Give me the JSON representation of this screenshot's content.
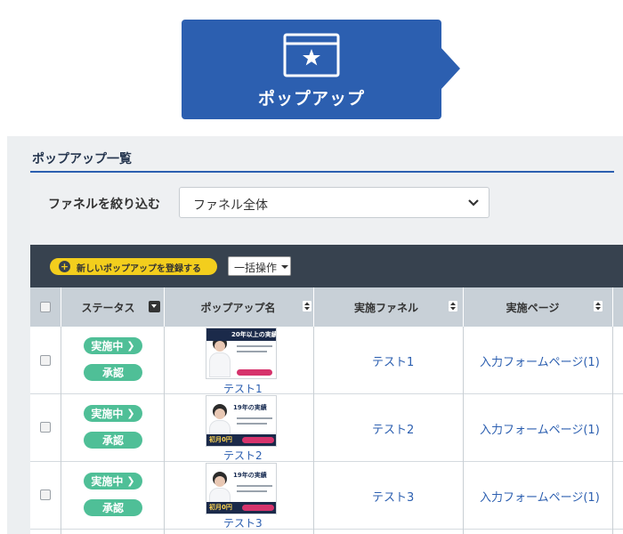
{
  "banner": {
    "label": "ポップアップ",
    "icon": "popup-window-star-icon"
  },
  "section": {
    "title": "ポップアップ一覧"
  },
  "filter": {
    "label": "ファネルを絞り込む",
    "selected": "ファネル全体"
  },
  "toolbar": {
    "new_label": "新しいポップアップを登録する",
    "bulk_label": "一括操作"
  },
  "table": {
    "columns": [
      "ステータス",
      "ポップアップ名",
      "実施ファネル",
      "実施ページ"
    ],
    "rows": [
      {
        "status": "実施中",
        "approval": "承認",
        "thumb_headline": "20年以上の実績",
        "name": "テスト1",
        "funnel": "テスト1",
        "page": "入力フォームページ(1)"
      },
      {
        "status": "実施中",
        "approval": "承認",
        "thumb_headline": "19年の実績",
        "thumb_price": "初月0円",
        "name": "テスト2",
        "funnel": "テスト2",
        "page": "入力フォームページ(1)"
      },
      {
        "status": "実施中",
        "approval": "承認",
        "thumb_headline": "19年の実績",
        "thumb_price": "初月0円",
        "name": "テスト3",
        "funnel": "テスト3",
        "page": "入力フォームページ(1)"
      }
    ]
  },
  "colors": {
    "brand": "#2c5fb0",
    "status_green": "#4fbf97",
    "toolbar": "#37424f",
    "accent_yellow": "#f3ce1d"
  }
}
